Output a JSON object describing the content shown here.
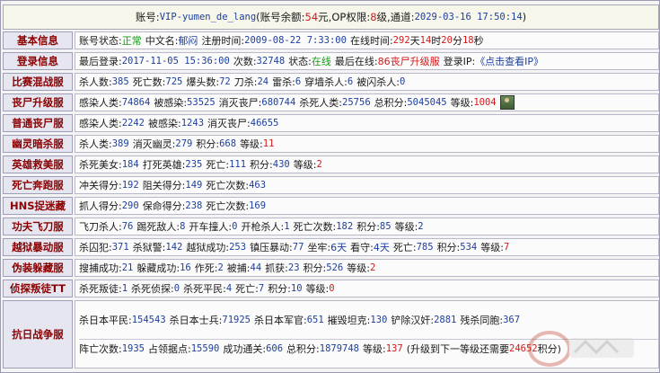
{
  "header": {
    "account_label": "账号:",
    "account": "VIP-yumen_de_lang",
    "balance_label": "(账号余额:",
    "balance": "54",
    "balance_unit": "元",
    "op_label": ",OP权限:",
    "op_level": "8",
    "op_unit": "级",
    "channel_label": ",通道:",
    "datetime": "2029-03-16 17:50:14",
    "close": ")"
  },
  "rows": {
    "basic": {
      "head": "基本信息",
      "status_label": "账号状态:",
      "status": "正常",
      "cname_label": "中文名:",
      "cname": "郁闷",
      "reg_label": "注册时间:",
      "reg": "2009-08-22 7:33:00",
      "online_label": "在线时间:",
      "online_h": "292",
      "u_h": "天",
      "online_m": "14",
      "u_m": "时",
      "online_min": "20",
      "u_min": "分",
      "online_s": "18",
      "u_s": "秒"
    },
    "login": {
      "head": "登录信息",
      "last_label": "最后登录:",
      "last": "2017-11-05 15:36:00",
      "count_label": "次数:",
      "count": "32748",
      "state_label": "状态:",
      "state": "在线",
      "lastonline_label": "最后在线:",
      "lastonline": "86丧尸升级服",
      "ip_label": "登录IP:",
      "ip_link": "《点击查看IP》"
    },
    "match": {
      "head": "比赛混战服",
      "a_l": "杀人数:",
      "a": "385",
      "b_l": "死亡数:",
      "b": "725",
      "c_l": "爆头数:",
      "c": "72",
      "d_l": "刀杀:",
      "d": "24",
      "e_l": "雷杀:",
      "e": "6",
      "f_l": "穿墙杀人:",
      "f": "6",
      "g_l": "被闪杀人:",
      "g": "0"
    },
    "zombie_up": {
      "head": "丧尸升级服",
      "a_l": "感染人类:",
      "a": "74864",
      "b_l": "被感染:",
      "b": "53525",
      "c_l": "消灭丧尸:",
      "c": "680744",
      "d_l": "杀死人类:",
      "d": "25756",
      "e_l": "总积分:",
      "e": "5045045",
      "f_l": "等级:",
      "f": "1004"
    },
    "zombie_normal": {
      "head": "普通丧尸服",
      "a_l": "感染人类:",
      "a": "2242",
      "b_l": "被感染:",
      "b": "1243",
      "c_l": "消灭丧尸:",
      "c": "46655"
    },
    "ghost": {
      "head": "幽灵暗杀服",
      "a_l": "杀人类:",
      "a": "389",
      "b_l": "消灭幽灵:",
      "b": "279",
      "c_l": "积分:",
      "c": "668",
      "d_l": "等级:",
      "d": "11"
    },
    "hero": {
      "head": "英雄救美服",
      "a_l": "杀死美女:",
      "a": "184",
      "b_l": "打死英雄:",
      "b": "235",
      "c_l": "死亡:",
      "c": "111",
      "d_l": "积分:",
      "d": "430",
      "e_l": "等级:",
      "e": "2"
    },
    "run": {
      "head": "死亡奔跑服",
      "a_l": "冲关得分:",
      "a": "192",
      "b_l": "阻关得分:",
      "b": "149",
      "c_l": "死亡次数:",
      "c": "463"
    },
    "hns": {
      "head": "HNS捉迷藏",
      "a_l": "抓人得分:",
      "a": "290",
      "b_l": "保命得分:",
      "b": "238",
      "c_l": "死亡次数:",
      "c": "169"
    },
    "kungfu": {
      "head": "功夫飞刀服",
      "a_l": "飞刀杀人:",
      "a": "76",
      "b_l": "踢死敌人:",
      "b": "8",
      "c_l": "开车撞人:",
      "c": "0",
      "d_l": "开枪杀人:",
      "d": "1",
      "e_l": "死亡次数:",
      "e": "182",
      "f_l": "积分:",
      "f": "85",
      "g_l": "等级:",
      "g": "2"
    },
    "jail": {
      "head": "越狱暴动服",
      "a_l": "杀囚犯:",
      "a": "371",
      "b_l": "杀狱警:",
      "b": "142",
      "c_l": "越狱成功:",
      "c": "253",
      "d_l": "镇压暴动:",
      "d": "77",
      "e_l": "坐牢:",
      "e": "6天",
      "f_l": "看守:",
      "f": "4天",
      "g_l": "死亡:",
      "g": "785",
      "h_l": "积分:",
      "h": "534",
      "i_l": "等级:",
      "i": "7"
    },
    "disguise": {
      "head": "伪装躲藏服",
      "a_l": "搜捕成功:",
      "a": "21",
      "b_l": "躲藏成功:",
      "b": "16",
      "c_l": "作死:",
      "c": "2",
      "d_l": "被捕:",
      "d": "44",
      "e_l": "抓获:",
      "e": "23",
      "f_l": "积分:",
      "f": "526",
      "g_l": "等级:",
      "g": "2"
    },
    "detect": {
      "head": "侦探叛徒TT",
      "a_l": "杀死叛徒:",
      "a": "1",
      "b_l": "杀死侦探:",
      "b": "0",
      "c_l": "杀死平民:",
      "c": "4",
      "d_l": "死亡:",
      "d": "7",
      "e_l": "积分:",
      "e": "10",
      "f_l": "等级:",
      "f": "0"
    },
    "war": {
      "head": "抗日战争服",
      "a_l": "杀日本平民:",
      "a": "154543",
      "b_l": "杀日本士兵:",
      "b": "71925",
      "c_l": "杀日本军官:",
      "c": "651",
      "d_l": "摧毁坦克:",
      "d": "130",
      "e_l": "铲除汉奸:",
      "e": "2881",
      "f_l": "残杀同胞:",
      "f": "367",
      "g_l": "阵亡次数:",
      "g": "1935",
      "h_l": "占领据点:",
      "h": "15590",
      "i_l": "成功通关:",
      "i": "606",
      "j_l": "总积分:",
      "j": "1879748",
      "k_l": "等级:",
      "k": "137",
      "l_l": "(升级到下一等级还需要",
      "l": "24652",
      "m_l": "积分)"
    }
  },
  "colors": {
    "header_text": "#8b0000",
    "value_blue": "#1d3f9e",
    "value_red": "#d21a1a",
    "value_green": "#119c11"
  }
}
